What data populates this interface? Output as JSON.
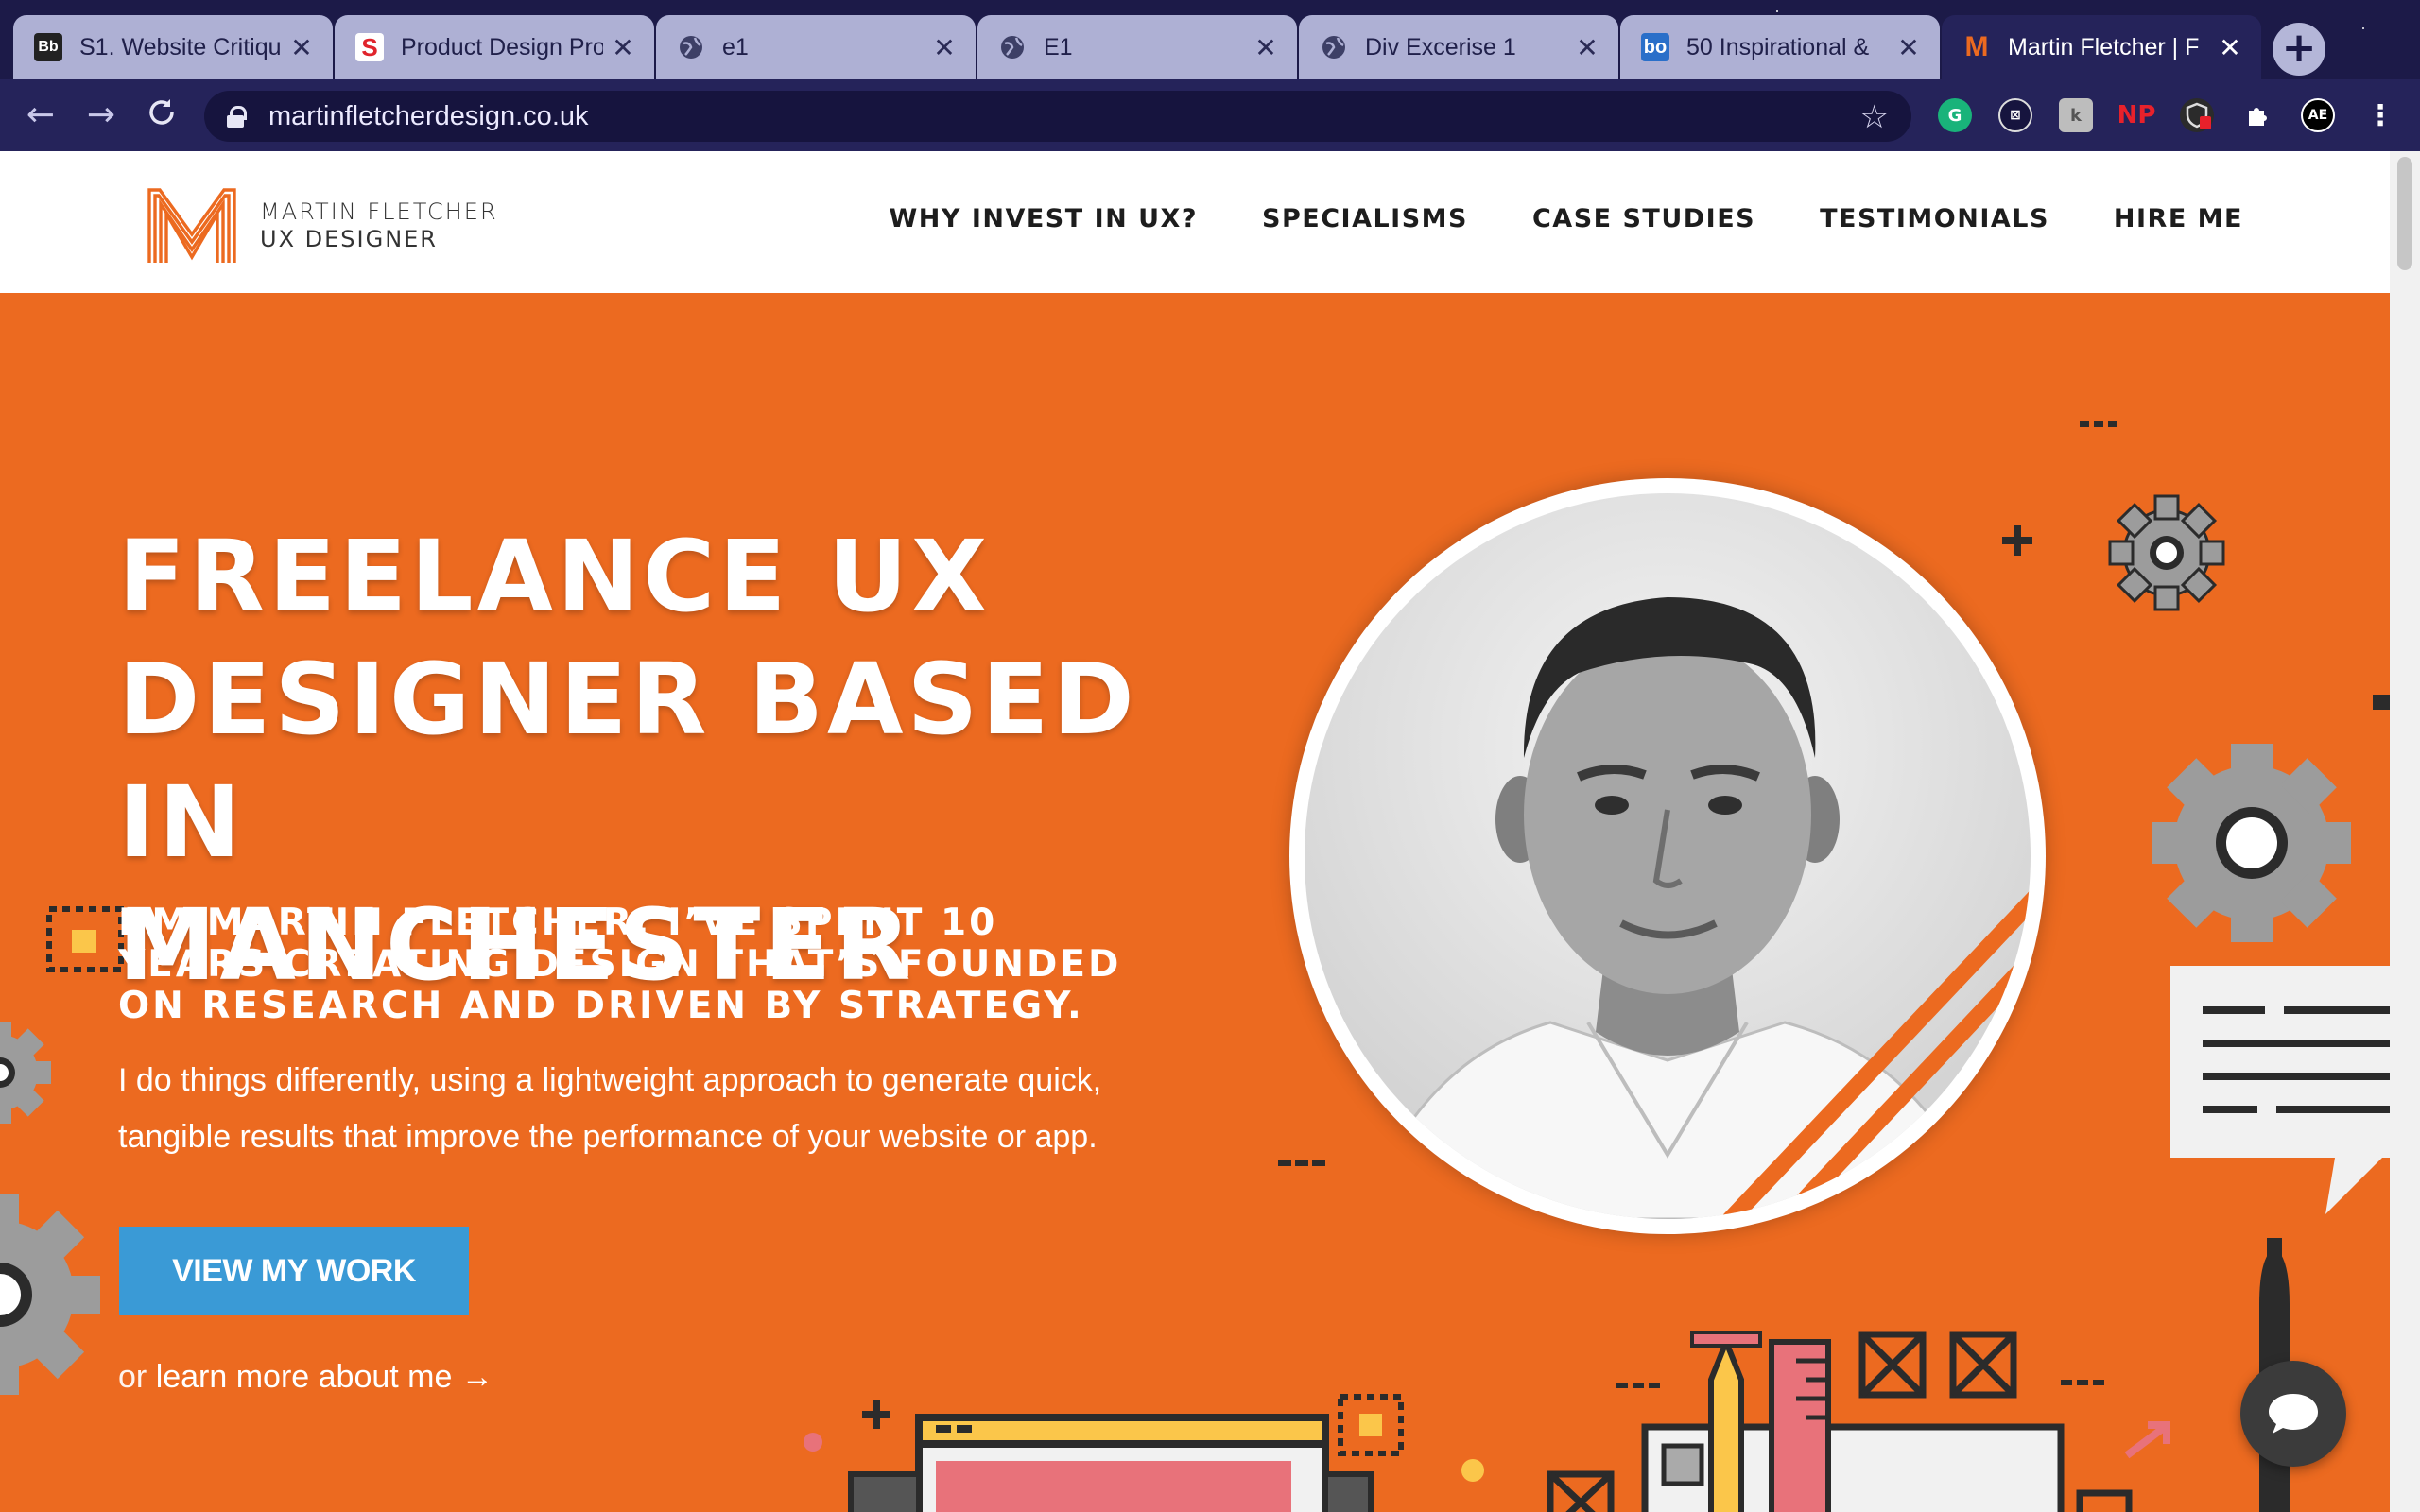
{
  "browser": {
    "tabs": [
      {
        "title": "S1. Website Critique",
        "favicon": "Bb"
      },
      {
        "title": "Product Design Pro",
        "favicon": "S"
      },
      {
        "title": "e1",
        "favicon": "globe"
      },
      {
        "title": "E1",
        "favicon": "globe"
      },
      {
        "title": "Div Excerise 1",
        "favicon": "globe"
      },
      {
        "title": "50 Inspirational &",
        "favicon": "bo"
      },
      {
        "title": "Martin Fletcher | F",
        "favicon": "M"
      }
    ],
    "url": "martinfletcherdesign.co.uk"
  },
  "header": {
    "logo_line1": "MARTIN FLETCHER",
    "logo_line2": "UX DESIGNER",
    "nav": [
      "WHY INVEST IN UX?",
      "SPECIALISMS",
      "CASE STUDIES",
      "TESTIMONIALS",
      "HIRE ME"
    ]
  },
  "hero": {
    "title_line1": "FREELANCE UX",
    "title_line2": "DESIGNER BASED IN",
    "title_line3": "MANCHESTER",
    "subtitle": "I’M MARTIN FLETCHER. I’VE SPENT 10 YEARS CREATING DESIGN THAT’S FOUNDED ON RESEARCH AND DRIVEN BY STRATEGY.",
    "description": "I do things differently, using a lightweight approach to generate quick, tangible results that improve the performance of your website or app.",
    "cta_label": "VIEW MY WORK",
    "learn_prefix": "or",
    "learn_link": "learn more about me",
    "learn_arrow": "→"
  },
  "colors": {
    "brand_orange": "#ec6a20",
    "cta_blue": "#3a9ad6",
    "chrome_dark": "#1c1a48"
  }
}
